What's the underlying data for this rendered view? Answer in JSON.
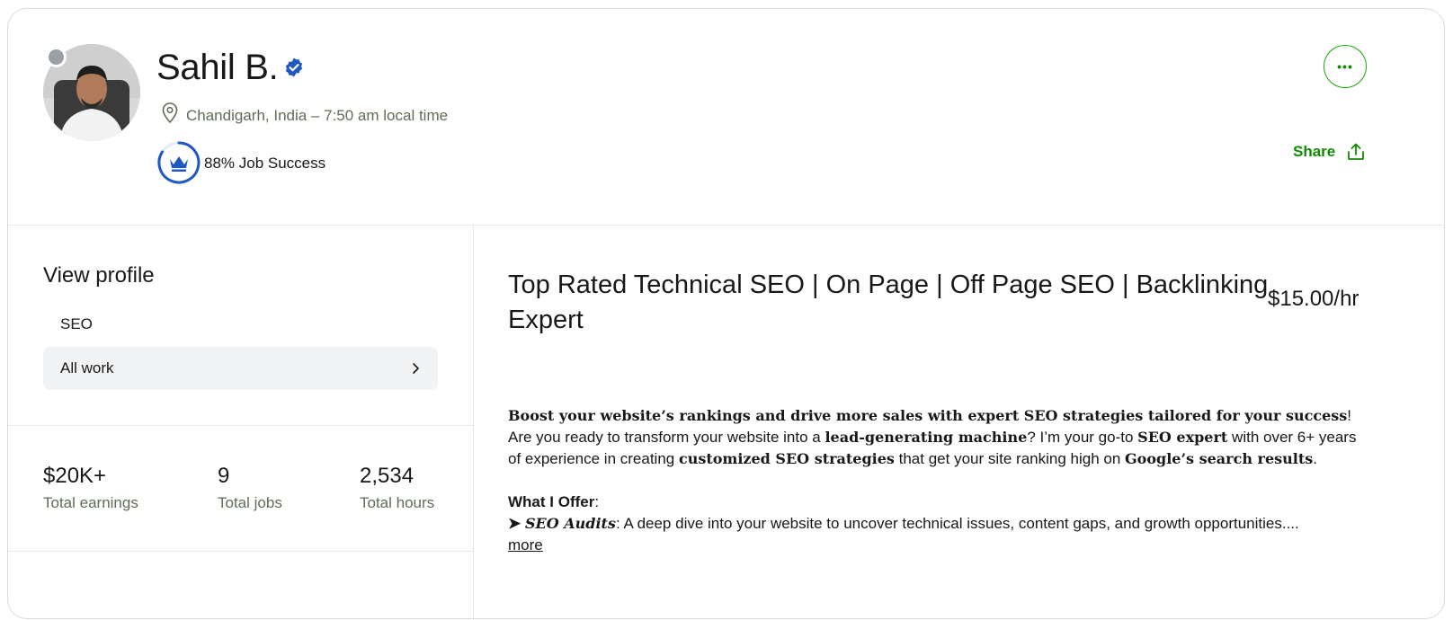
{
  "profile": {
    "name": "Sahil B.",
    "location": "Chandigarh, India – 7:50 am local time",
    "job_success": "88% Job Success",
    "share_label": "Share",
    "more_actions_label": "•••"
  },
  "sidebar": {
    "view_profile": "View profile",
    "items": [
      {
        "label": "SEO"
      },
      {
        "label": "All work"
      }
    ],
    "stats": [
      {
        "value": "$20K+",
        "label": "Total earnings"
      },
      {
        "value": "9",
        "label": "Total jobs"
      },
      {
        "value": "2,534",
        "label": "Total hours"
      }
    ]
  },
  "main": {
    "title": "Top Rated Technical SEO | On Page | Off Page SEO | Backlinking Expert",
    "rate": "$15.00/hr",
    "desc": {
      "line1_bold": "Boost your website’s rankings and drive more sales with expert SEO strategies tailored for your success",
      "line1_end": "!",
      "p2_a": "Are you ready to transform your website into a ",
      "p2_b": "lead-generating machine",
      "p2_c": "? I’m your go-to ",
      "p2_d": "SEO expert",
      "p2_e": " with over 6+ years of experience in creating ",
      "p2_f": "customized SEO strategies",
      "p2_g": " that get your site ranking high on ",
      "p2_h": "Google’s search results",
      "p2_i": ".",
      "offer_head": "What I Offer",
      "offer_colon": ":",
      "bullet": "➤ ",
      "audit_bold": "SEO Audits",
      "audit_text": ": A deep dive into your website to uncover technical issues, content gaps, and growth opportunities....",
      "more": "more"
    }
  },
  "colors": {
    "brand_green": "#108a00",
    "verified_blue": "#1f57c3",
    "muted_text": "#5e6d55"
  },
  "icons": [
    "verified-badge-icon",
    "location-pin-icon",
    "crown-badge-icon",
    "more-dots-icon",
    "share-icon",
    "chevron-right-icon"
  ]
}
